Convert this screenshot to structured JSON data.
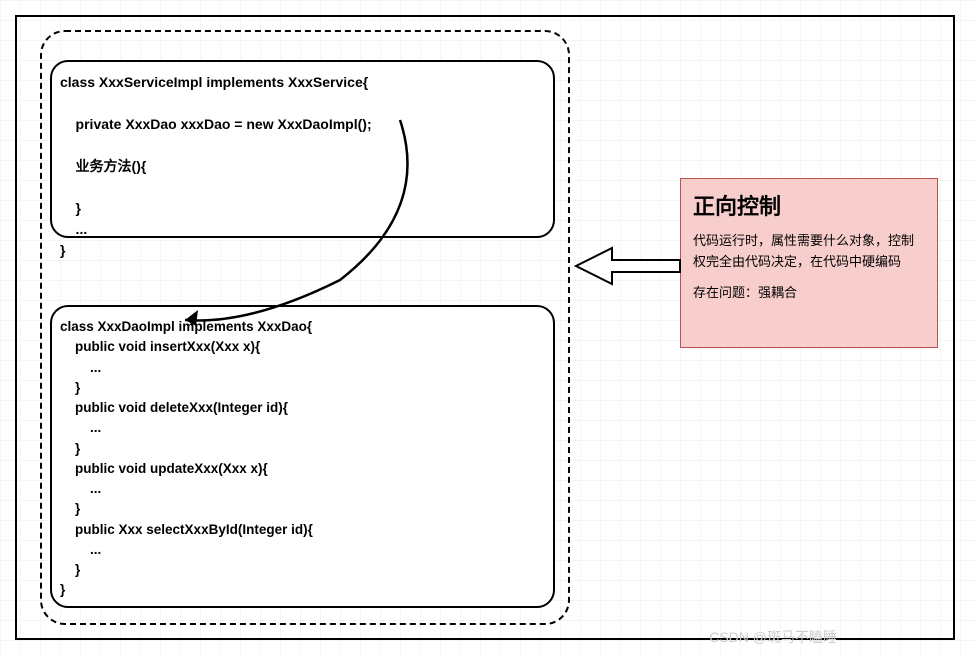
{
  "codeBox1": {
    "lines": [
      "class XxxServiceImpl implements XxxService{",
      "",
      "    private XxxDao xxxDao = new XxxDaoImpl();",
      "",
      "    业务方法(){",
      "",
      "    }",
      "    ...",
      "}"
    ]
  },
  "codeBox2": {
    "lines": [
      "class XxxDaoImpl implements XxxDao{",
      "    public void insertXxx(Xxx x){",
      "        ...",
      "    }",
      "    public void deleteXxx(Integer id){",
      "        ...",
      "    }",
      "    public void updateXxx(Xxx x){",
      "        ...",
      "    }",
      "    public Xxx selectXxxById(Integer id){",
      "        ...",
      "    }",
      "}"
    ]
  },
  "callout": {
    "title": "正向控制",
    "body": "代码运行时，属性需要什么对象，控制权完全由代码决定，在代码中硬编码",
    "footer": "存在问题：强耦合"
  },
  "watermark": "CSDN @斑马不瞌睡"
}
